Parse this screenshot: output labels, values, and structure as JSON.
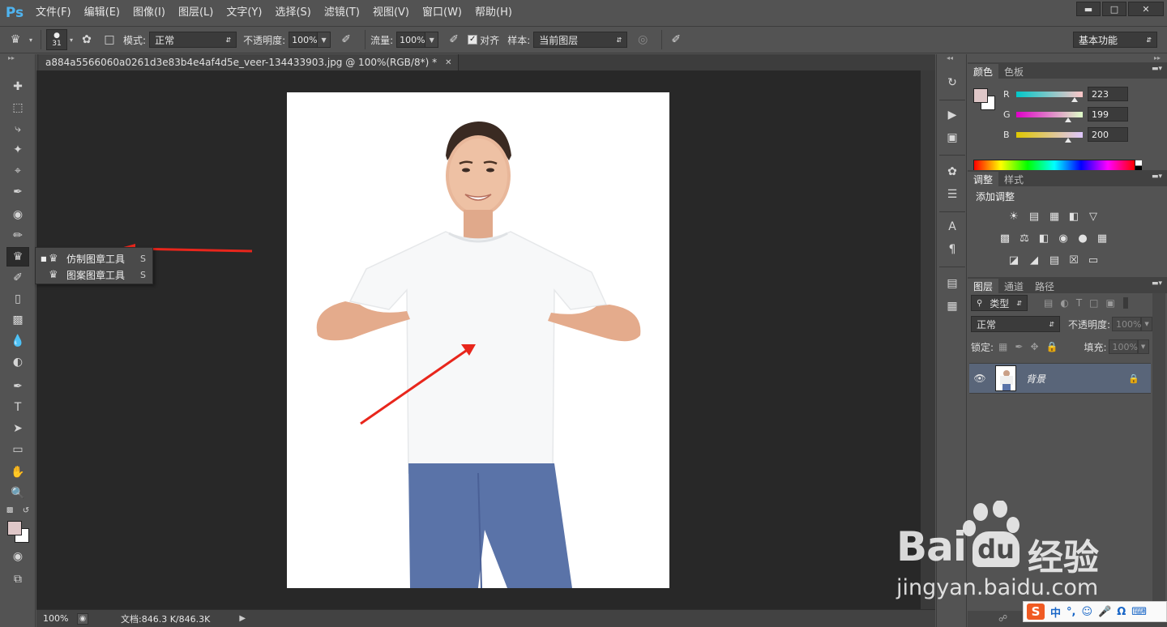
{
  "app": {
    "logo": "Ps",
    "menu": [
      "文件(F)",
      "编辑(E)",
      "图像(I)",
      "图层(L)",
      "文字(Y)",
      "选择(S)",
      "滤镜(T)",
      "视图(V)",
      "窗口(W)",
      "帮助(H)"
    ],
    "window_buttons": [
      "minimize-icon",
      "maximize-icon",
      "close-icon"
    ]
  },
  "options": {
    "brush_size": "31",
    "mode_label": "模式:",
    "mode_value": "正常",
    "opacity_label": "不透明度:",
    "opacity_value": "100%",
    "flow_label": "流量:",
    "flow_value": "100%",
    "aligned_label": "对齐",
    "aligned_checked": true,
    "sample_label": "样本:",
    "sample_value": "当前图层",
    "workspace": "基本功能"
  },
  "document": {
    "tab_title": "a884a5566060a0261d3e83b4e4af4d5e_veer-134433903.jpg @ 100%(RGB/8*) *",
    "status_zoom": "100%",
    "status_doc": "文档:846.3 K/846.3K"
  },
  "flyout": {
    "items": [
      {
        "label": "仿制图章工具",
        "key": "S",
        "selected": true
      },
      {
        "label": "图案图章工具",
        "key": "S",
        "selected": false
      }
    ]
  },
  "colors": {
    "foreground": "#dfc7c8",
    "background": "#ffffff",
    "accent_arrow": "#e8261c",
    "selected_layer": "#596579"
  },
  "color_panel": {
    "tabs": [
      "颜色",
      "色板"
    ],
    "channels": [
      {
        "label": "R",
        "value": "223",
        "level": 0.875
      },
      {
        "label": "G",
        "value": "199",
        "level": 0.78
      },
      {
        "label": "B",
        "value": "200",
        "level": 0.784
      }
    ]
  },
  "adjustments_panel": {
    "tabs": [
      "调整",
      "样式"
    ],
    "title": "添加调整"
  },
  "layers_panel": {
    "tabs": [
      "图层",
      "通道",
      "路径"
    ],
    "filter_label": "类型",
    "blend_mode": "正常",
    "opacity_label": "不透明度:",
    "opacity_value": "100%",
    "lock_label": "锁定:",
    "fill_label": "填充:",
    "fill_value": "100%",
    "layers": [
      {
        "name": "背景",
        "visible": true,
        "locked": true
      }
    ]
  },
  "watermark": {
    "brand": "Bai",
    "brand2": "du",
    "brand_cn": "经验",
    "url": "jingyan.baidu.com"
  },
  "ime": {
    "logo": "S",
    "lang": "中"
  }
}
